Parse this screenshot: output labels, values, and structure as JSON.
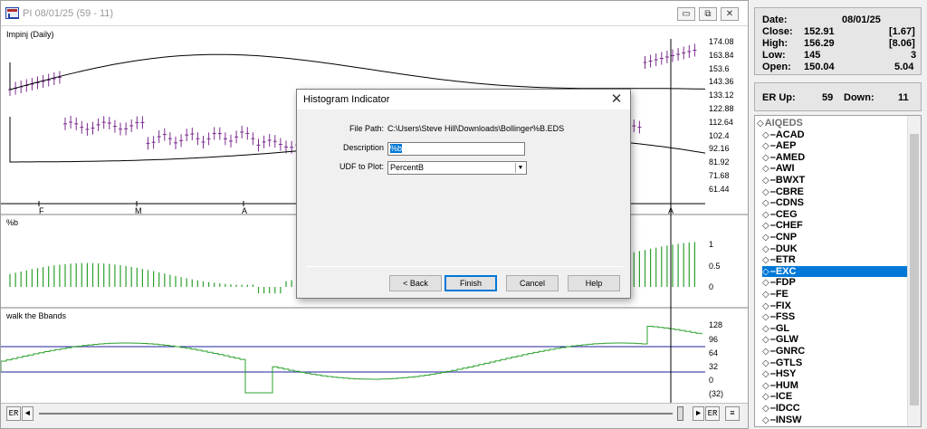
{
  "chart_window": {
    "title": "PI 08/01/25 (59 - 11)",
    "buttons": {
      "minimize": "▭",
      "restore": "⧉",
      "close": "✕"
    }
  },
  "chart": {
    "panes": [
      {
        "label": "Impinj (Daily)",
        "axis_ticks": [
          "174.08",
          "163.84",
          "153.6",
          "143.36",
          "133.12",
          "122.88",
          "112.64",
          "102.4",
          "92.16",
          "81.92",
          "71.68",
          "61.44"
        ]
      },
      {
        "label": "%b",
        "axis_ticks": [
          "1",
          "0.5",
          "0"
        ]
      },
      {
        "label": "walk the Bbands",
        "axis_ticks": [
          "128",
          "96",
          "64",
          "32",
          "0",
          "(32)"
        ]
      }
    ],
    "month_labels": [
      "F",
      "M",
      "A",
      "A"
    ],
    "colors": {
      "price_bar": "#7b2d8e",
      "histogram": "#2ca02c",
      "band_line": "#000000",
      "step_line": "#2ca02c",
      "ref_line": "#1f1f9f",
      "cursor_line": "#000000"
    }
  },
  "scrollbar": {
    "left_er": "ER",
    "left_arrow": "◄",
    "right_arrow": "►",
    "right_er": "ER",
    "menu_icon": "≡"
  },
  "info": {
    "date_label": "Date:",
    "date_value": "08/01/25",
    "close_label": "Close:",
    "close_value": "152.91",
    "close_change": "[1.67]",
    "high_label": "High:",
    "high_value": "156.29",
    "high_change": "[8.06]",
    "low_label": "Low:",
    "low_value": "145",
    "low_change": "3",
    "open_label": "Open:",
    "open_value": "150.04",
    "open_change": "5.04"
  },
  "er": {
    "up_label": "ER Up:",
    "up_value": "59",
    "down_label": "Down:",
    "down_value": "11"
  },
  "symbols": {
    "group": "AIQEDS",
    "items": [
      "ACAD",
      "AEP",
      "AMED",
      "AWI",
      "BWXT",
      "CBRE",
      "CDNS",
      "CEG",
      "CHEF",
      "CNP",
      "DUK",
      "ETR",
      "EXC",
      "FDP",
      "FE",
      "FIX",
      "FSS",
      "GL",
      "GLW",
      "GNRC",
      "GTLS",
      "HSY",
      "HUM",
      "ICE",
      "IDCC",
      "INSW"
    ],
    "selected": "EXC"
  },
  "dialog": {
    "title": "Histogram Indicator",
    "close_icon": "✕",
    "file_path_label": "File Path:",
    "file_path_value": "C:\\Users\\Steve Hill\\Downloads\\Bollinger%B.EDS",
    "description_label": "Description",
    "description_value": "%b",
    "udf_label": "UDF to Plot:",
    "udf_value": "PercentB",
    "back_label": "< Back",
    "finish_label": "Finish",
    "cancel_label": "Cancel",
    "help_label": "Help"
  }
}
